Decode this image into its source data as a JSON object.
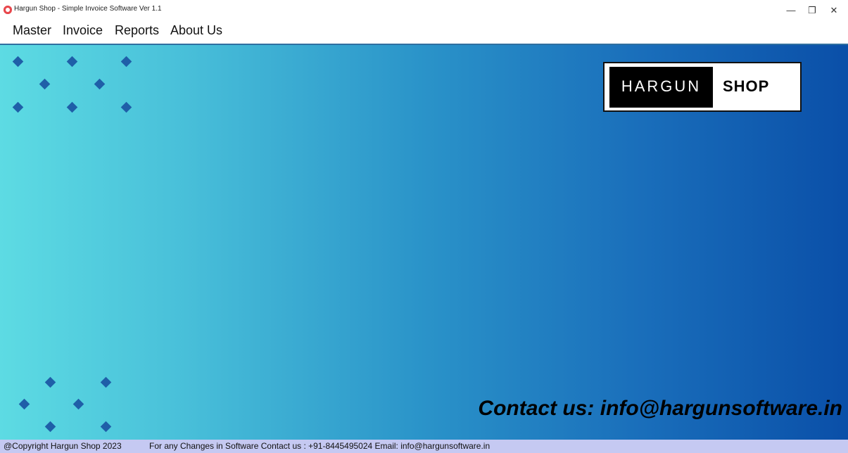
{
  "window": {
    "title": "Hargun Shop - Simple Invoice Software Ver 1.1",
    "icon": "app-icon",
    "controls": {
      "minimize": "—",
      "maximize": "❐",
      "close": "✕"
    }
  },
  "menu": {
    "items": [
      {
        "label": "Master"
      },
      {
        "label": "Invoice"
      },
      {
        "label": "Reports"
      },
      {
        "label": "About Us"
      }
    ]
  },
  "main": {
    "logo": {
      "left_text": "HARGUN",
      "right_text": "SHOP"
    },
    "contact": "Contact us: info@hargunsoftware.in",
    "colors": {
      "gradient_start": "#5ddbe3",
      "gradient_end": "#0a4fa8",
      "diamond": "#1f5fa8"
    }
  },
  "statusbar": {
    "copyright": "@Copyright Hargun Shop 2023",
    "contact": "For any Changes in Software Contact us : +91-8445495024 Email: info@hargunsoftware.in",
    "background": "#c5c9f2"
  }
}
